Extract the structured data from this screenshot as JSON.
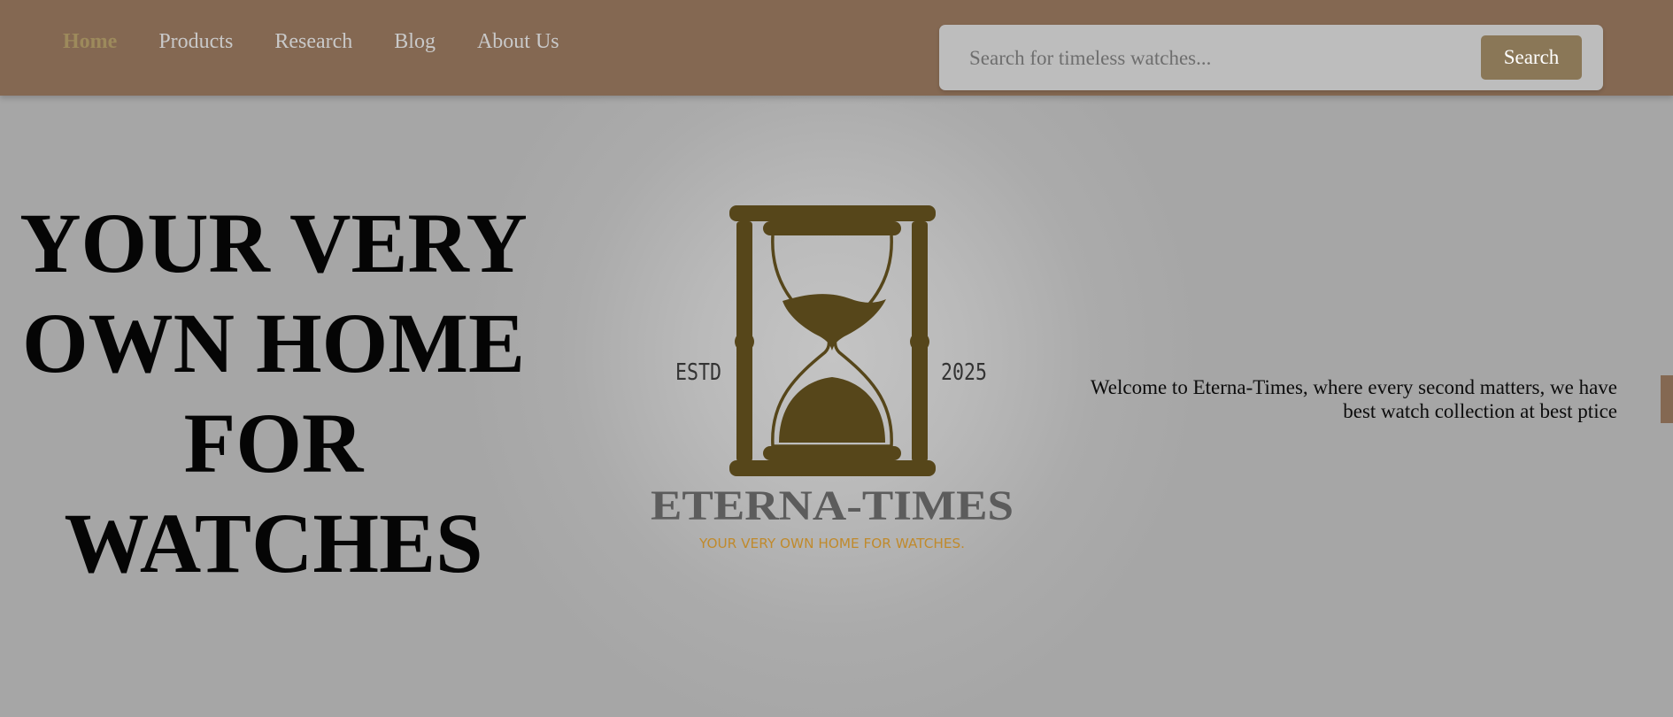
{
  "nav": {
    "links": [
      {
        "label": "Home",
        "active": true
      },
      {
        "label": "Products",
        "active": false
      },
      {
        "label": "Research",
        "active": false
      },
      {
        "label": "Blog",
        "active": false
      },
      {
        "label": "About Us",
        "active": false
      }
    ]
  },
  "search": {
    "placeholder": "Search for timeless watches...",
    "value": "",
    "button_label": "Search"
  },
  "hero": {
    "title_lines": [
      "YOUR VERY",
      "OWN HOME",
      "FOR",
      "WATCHES"
    ],
    "welcome": "Welcome to Eterna-Times, where every second matters, we have best watch collection at best ptice"
  },
  "logo": {
    "estd_label": "ESTD",
    "year": "2025",
    "brand": "ETERNA-TIMES",
    "tagline": "YOUR VERY OWN HOME FOR WATCHES.",
    "icon": "hourglass-icon"
  },
  "colors": {
    "navbar": "#846852",
    "active_link": "#9d8a5c",
    "search_button": "#8a7757",
    "logo_dark": "#56461a",
    "brand_text": "#5c5c5c",
    "tagline": "#c08a2c",
    "background": "#a8a8a8"
  }
}
